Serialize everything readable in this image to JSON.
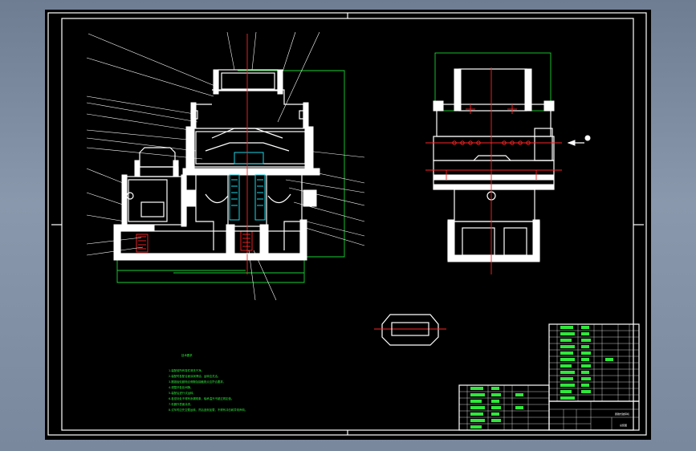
{
  "drawing": {
    "background": "#000000",
    "line_color": "#ffffff",
    "dimension_color": "#19d233",
    "centerline_color": "#ff2424",
    "section_color": "#16d9e8"
  },
  "views": [
    {
      "name": "front-section-view"
    },
    {
      "name": "side-view"
    },
    {
      "name": "detail-part-view"
    }
  ],
  "technical_notes": {
    "heading": "技术要求",
    "lines": [
      "1.装配前所有零件清洗干净。",
      "2.装配时各配合面涂润滑油，运转应灵活。",
      "3.圆锥齿轮副啮合侧隙及接触斑点应符合要求。",
      "4.调整好各处间隙。",
      "5.装配后进行试运转。",
      "6.各密封处不得有渗漏现象，轴承温升不超过规定值。",
      "7.机器外表面涂漆。",
      "8.试车时应先空载运转，然后逐渐加载，不得有冲击和异常声响。"
    ]
  },
  "title_block": {
    "drawing_title": "圆锥式破碎机",
    "drawing_number": "总装图"
  }
}
